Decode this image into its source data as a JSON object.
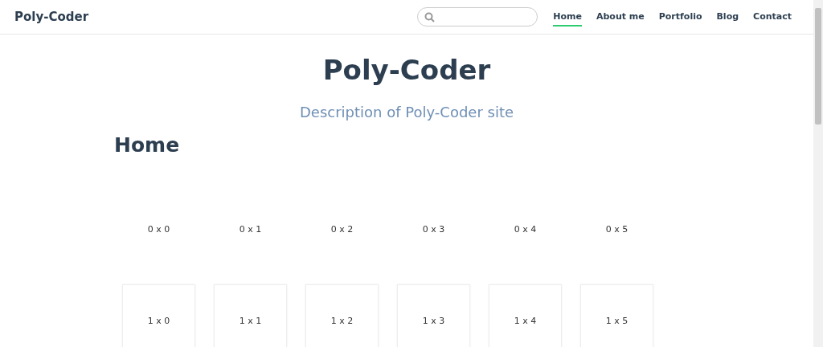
{
  "navbar": {
    "brand": "Poly-Coder",
    "links": [
      {
        "label": "Home",
        "selected": true
      },
      {
        "label": "About me",
        "selected": false
      },
      {
        "label": "Portfolio",
        "selected": false
      },
      {
        "label": "Blog",
        "selected": false
      },
      {
        "label": "Contact",
        "selected": false
      }
    ]
  },
  "hero": {
    "title": "Poly-Coder",
    "description": "Description of Poly-Coder site"
  },
  "section": {
    "heading": "Home"
  },
  "grid": {
    "rows": [
      {
        "bordered": false,
        "cells": [
          "0 x 0",
          "0 x 1",
          "0 x 2",
          "0 x 3",
          "0 x 4",
          "0 x 5"
        ]
      },
      {
        "bordered": true,
        "cells": [
          "1 x 0",
          "1 x 1",
          "1 x 2",
          "1 x 3",
          "1 x 4",
          "1 x 5"
        ]
      }
    ]
  }
}
